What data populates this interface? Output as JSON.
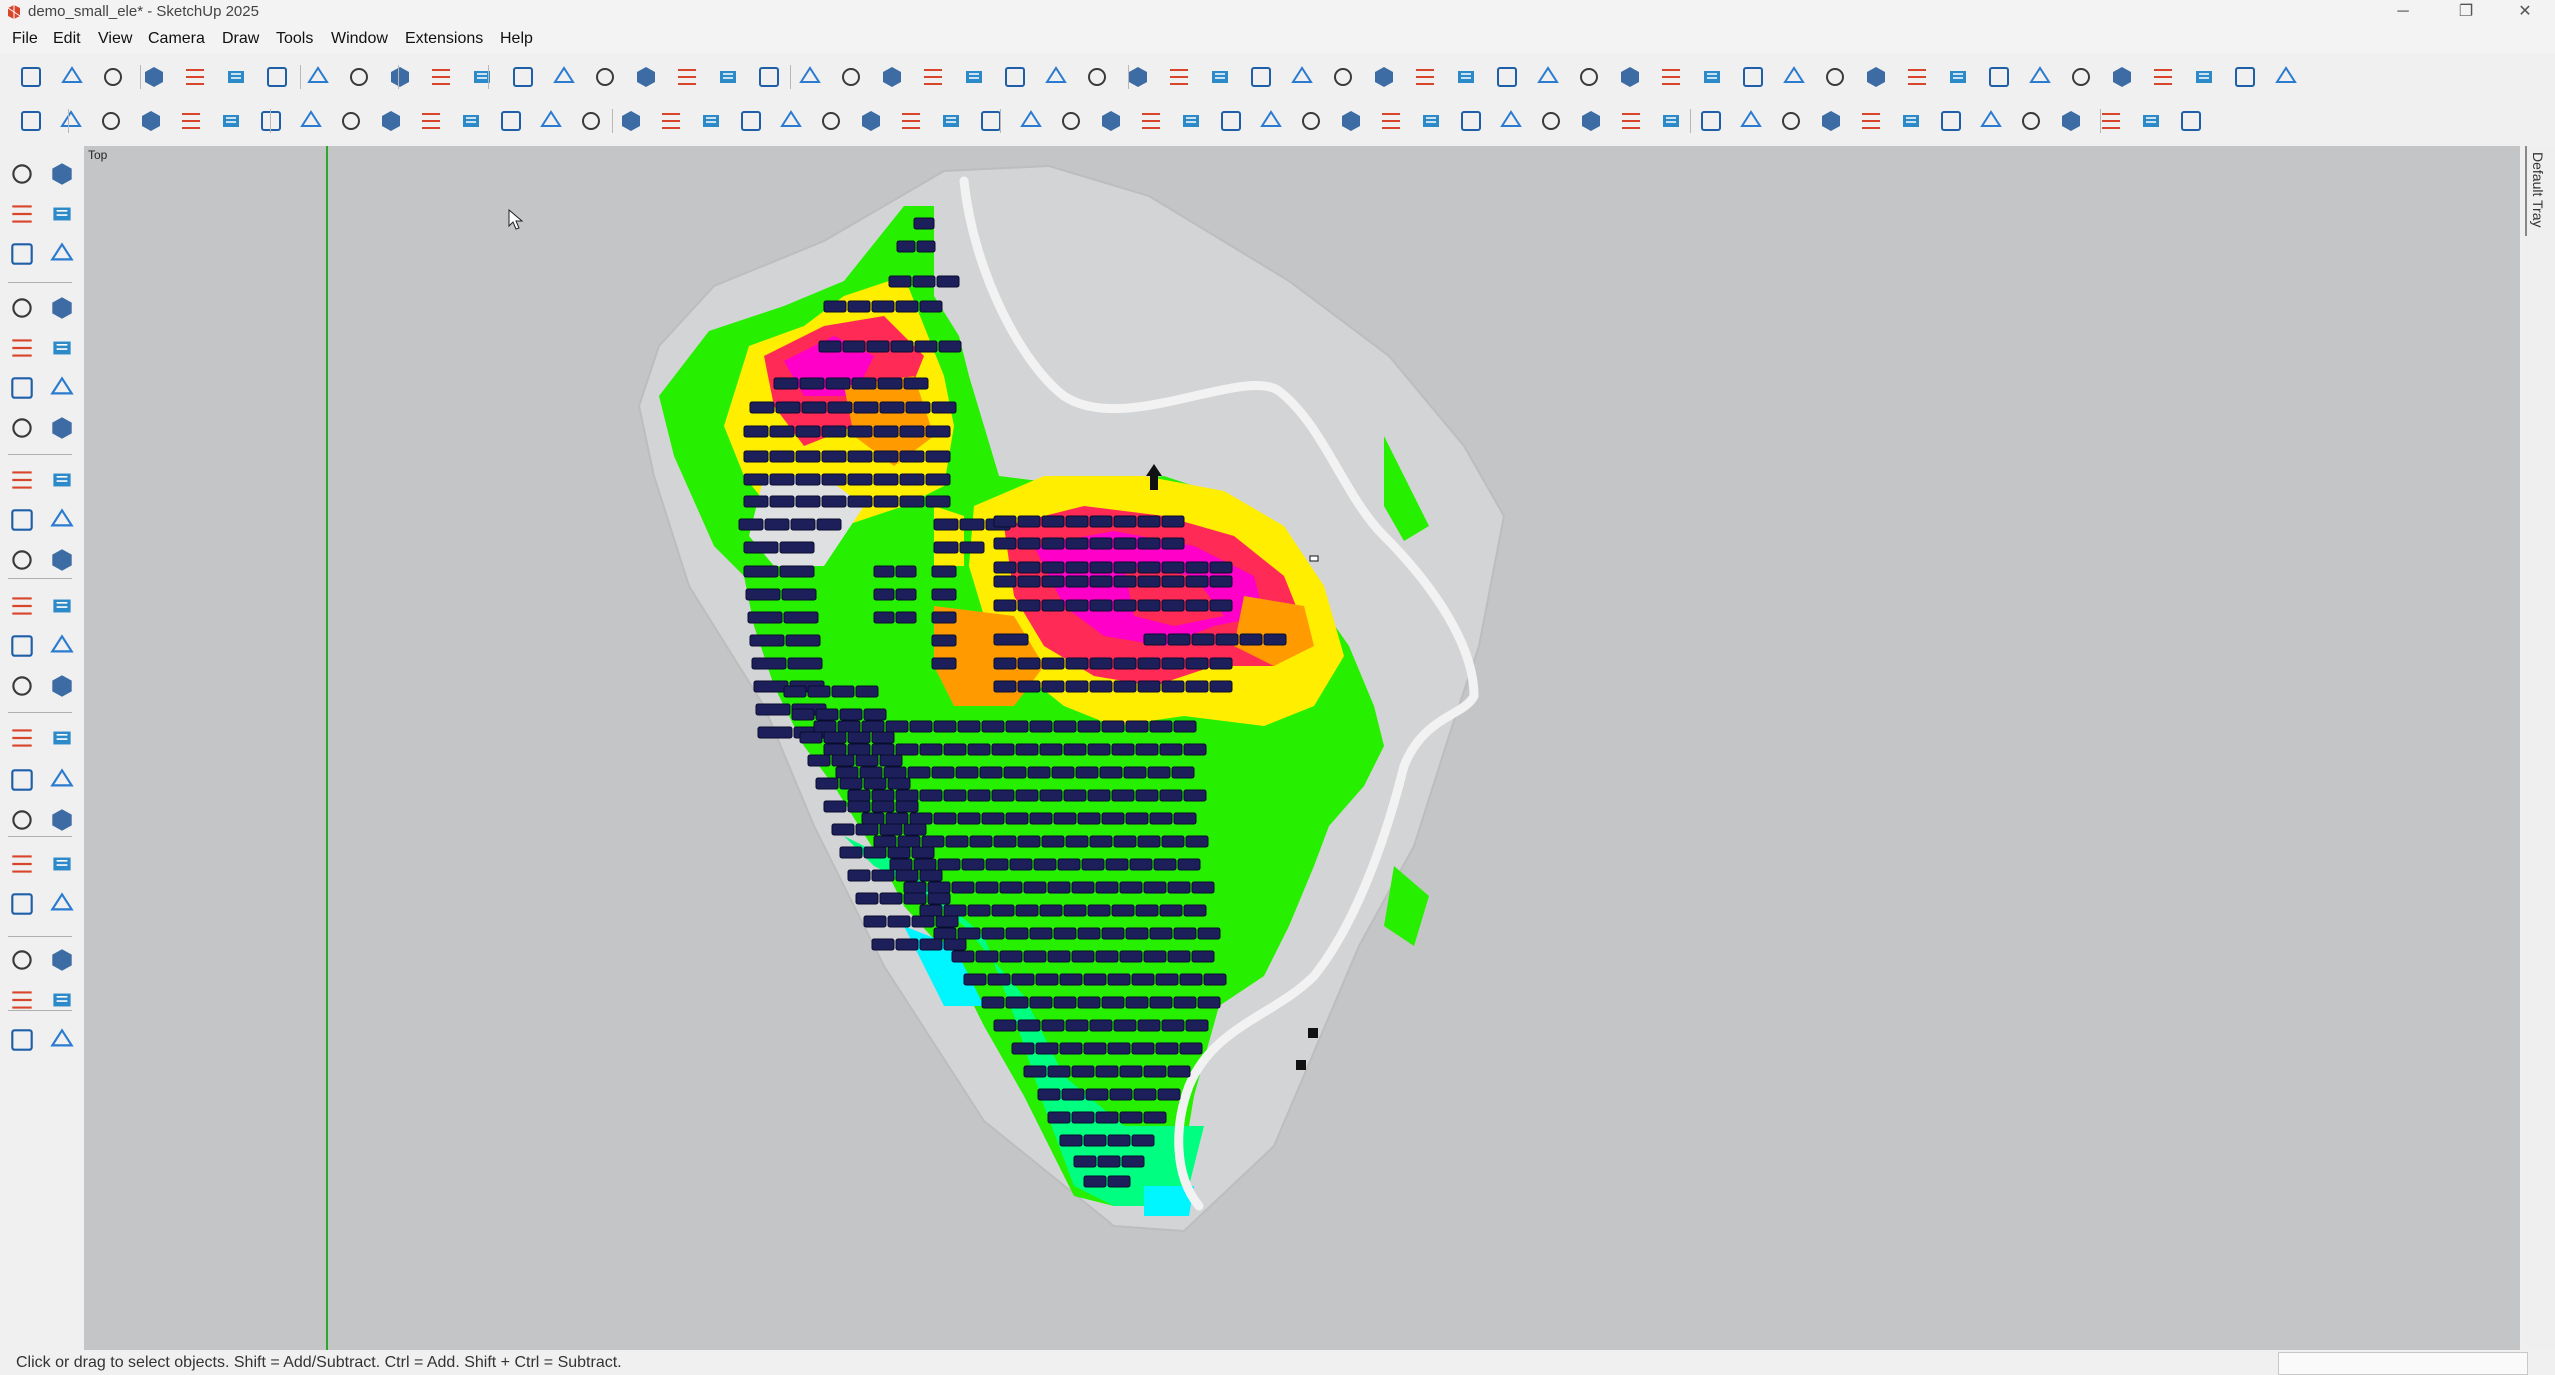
{
  "window": {
    "title": "demo_small_ele* - SketchUp 2025",
    "minimize_glyph": "─",
    "restore_glyph": "❐",
    "close_glyph": "✕"
  },
  "menu": {
    "items": [
      "File",
      "Edit",
      "View",
      "Camera",
      "Draw",
      "Tools",
      "Window",
      "Extensions",
      "Help"
    ]
  },
  "viewport": {
    "view_label": "Top",
    "background": "#c4c5c7",
    "terrain_colors": [
      "#ff00c8",
      "#ff2a55",
      "#ff9a00",
      "#ffee00",
      "#b6ff00",
      "#26f000",
      "#00ff80",
      "#00f6ff"
    ],
    "panel_color": "#1c1f5a",
    "road_color": "#f2f2f2"
  },
  "tray": {
    "label": "Default Tray"
  },
  "status": {
    "message": "Click or drag to select objects. Shift = Add/Subtract. Ctrl = Add. Shift + Ctrl = Subtract."
  },
  "toolbar_icons": {
    "row1": [
      "new-file-icon",
      "open-folder-icon",
      "save-icon",
      "cut-icon",
      "copy-icon",
      "paste-icon",
      "erase-icon",
      "undo-icon",
      "redo-icon",
      "print-icon",
      "model-info-icon",
      "iso-view-icon",
      "top-view-icon",
      "front-view-icon",
      "right-view-icon",
      "back-view-icon",
      "left-view-icon",
      "bottom-view-icon",
      "xray-icon",
      "back-edges-icon",
      "wireframe-icon",
      "hidden-line-icon",
      "shaded-icon",
      "shaded-texture-icon",
      "monochrome-icon",
      "ambient-icon",
      "warehouse-icon",
      "text-icon",
      "tower-icon",
      "pin-icon",
      "mast-icon",
      "tower-2-icon",
      "cube-icon",
      "grid-icon",
      "component-icon",
      "scale-icon",
      "hide-icon",
      "section-icon",
      "zoom-icon",
      "angle-icon",
      "height-icon",
      "measure-icon",
      "swap-icon",
      "list-icon",
      "lock-icon",
      "slope-icon",
      "pylon-icon",
      "cars-icon",
      "table-icon",
      "tray-icon",
      "expand-icon",
      "shrink-icon",
      "auto-icon",
      "export-icon",
      "layout-icon",
      "compass-icon"
    ],
    "row2": [
      "menu-icon",
      "sun-icon",
      "globe-icon",
      "frame-icon",
      "tent-icon",
      "mountain-icon",
      "panel-icon",
      "panels-tilt-icon",
      "array-icon",
      "string-icon",
      "delete-icon",
      "percent-icon",
      "shadow-icon",
      "pole-icon",
      "pipe-icon",
      "combiner-icon",
      "inverter-icon",
      "cable-icon",
      "search-icon",
      "wave-icon",
      "search-zoom-icon",
      "target-icon",
      "link-icon",
      "fence-icon",
      "axes-icon",
      "cabinet-icon",
      "transformer-icon",
      "cloud-icon",
      "ruler-icon",
      "layout-tree-icon",
      "photo-icon",
      "cut-icon",
      "move-icon",
      "table-icon",
      "settings-bar-icon",
      "dropbox-icon",
      "db-icon",
      "yen-icon",
      "kwh-icon",
      "irr-icon",
      "clipboard-icon",
      "gear-icon",
      "users-icon",
      "edit-icon",
      "help-icon",
      "cloud-up-icon",
      "refresh-icon",
      "database-icon",
      "loss-icon",
      "bi-icon",
      "play-icon",
      "fit-icon",
      "cross-icon",
      "image-icon",
      "obj-icon"
    ]
  }
}
